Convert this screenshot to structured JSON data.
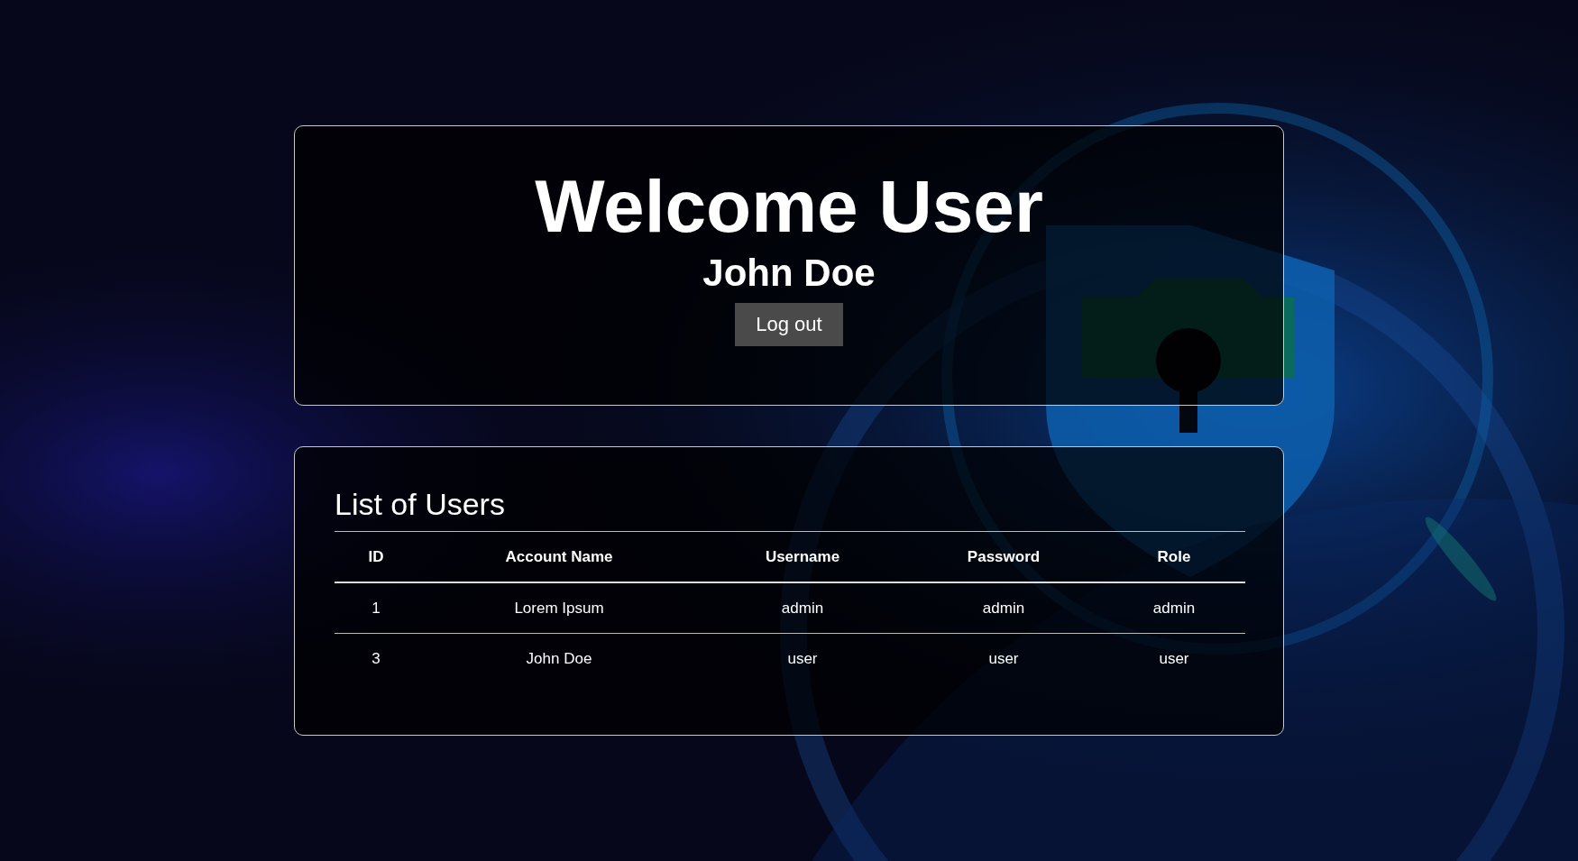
{
  "header": {
    "title": "Welcome User",
    "user_name": "John Doe",
    "logout_button": "Log out"
  },
  "users_table": {
    "title": "List of Users",
    "columns": [
      "ID",
      "Account Name",
      "Username",
      "Password",
      "Role"
    ],
    "rows": [
      {
        "cells": [
          "1",
          "Lorem Ipsum",
          "admin",
          "admin",
          "admin"
        ]
      },
      {
        "cells": [
          "3",
          "John Doe",
          "user",
          "user",
          "user"
        ]
      }
    ]
  }
}
